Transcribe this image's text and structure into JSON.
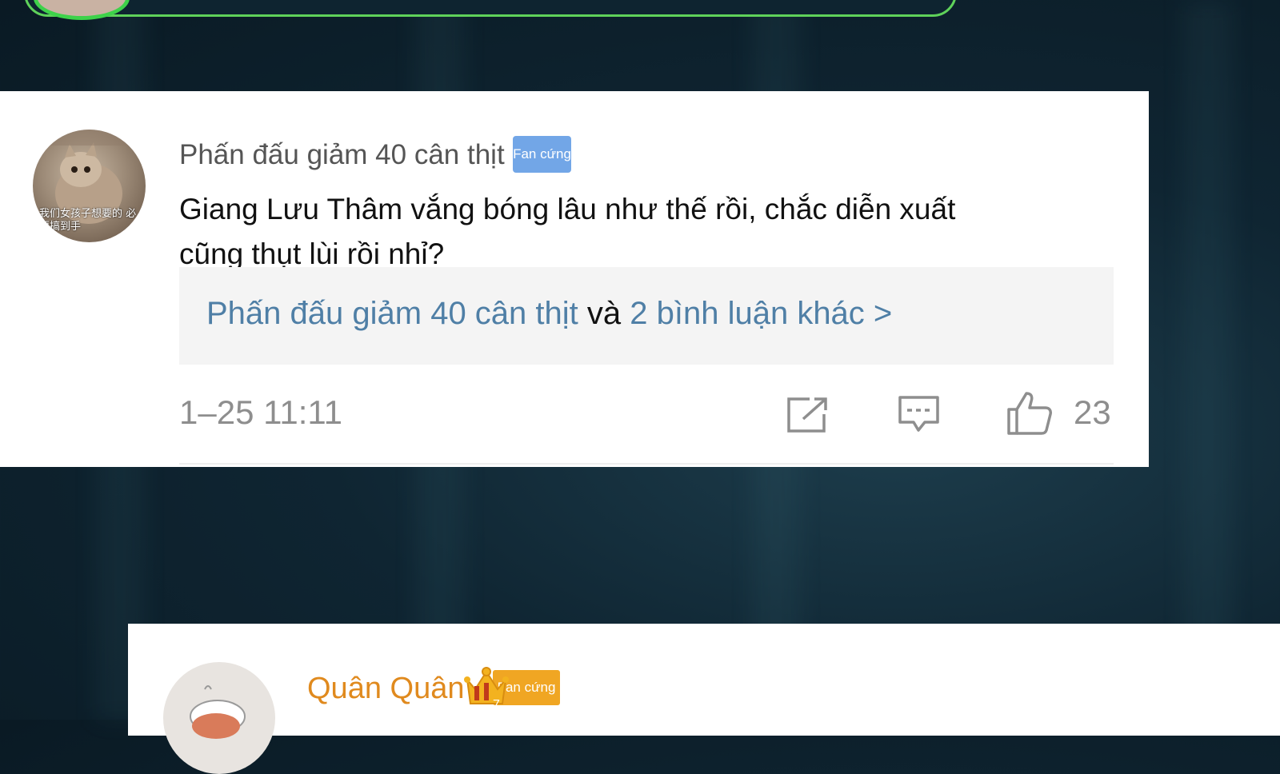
{
  "comment1": {
    "username": "Phấn đấu giảm 40 cân thịt",
    "badge": "Fan cứng",
    "avatar_caption": "我们女孩子想要的 必须搞到手",
    "text": "Giang Lưu Thâm vắng bóng lâu như thế rồi, chắc diễn xuất cũng thụt lùi rồi nhỉ?",
    "replies": {
      "first_user": "Phấn đấu giảm 40 cân thịt",
      "connector": " và ",
      "more_link": "2 bình luận khác >"
    },
    "timestamp": "1–25 11:11",
    "like_count": "23",
    "icons": [
      "share-icon",
      "reply-comment-icon",
      "thumbs-up-icon"
    ]
  },
  "comment2": {
    "username": "Quân Quân",
    "badge": "Fan cứng",
    "badge_level": "7",
    "icons": [
      "crown-icon"
    ]
  },
  "colors": {
    "background": "#0f2532",
    "link": "#4f7fa6",
    "badge_blue": "#72a6e7",
    "badge_orange": "#f0a623",
    "username_orange": "#e08a1e",
    "top_panel_border": "#5fd25a"
  }
}
